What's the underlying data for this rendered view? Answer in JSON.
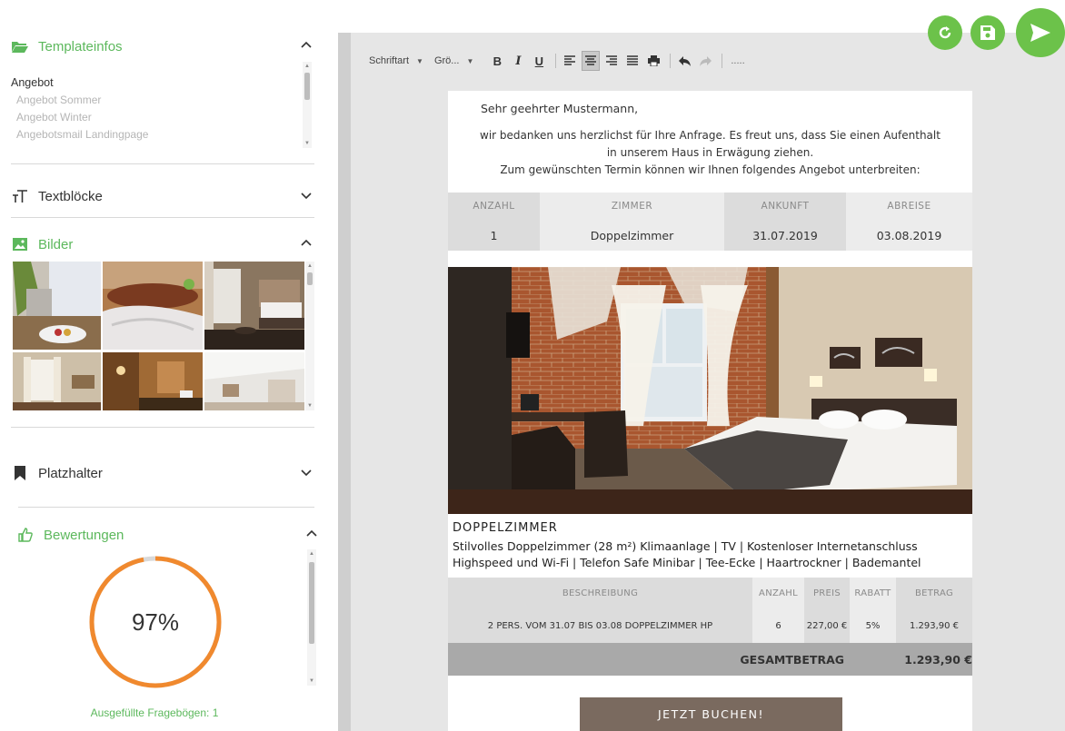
{
  "sidebar": {
    "templateinfos": {
      "title": "Templateinfos",
      "items": [
        {
          "label": "Angebot"
        },
        {
          "label": "Angebot Sommer"
        },
        {
          "label": "Angebot Winter"
        },
        {
          "label": "Angebotsmail Landingpage"
        }
      ]
    },
    "textbloecke": {
      "title": "Textblöcke"
    },
    "bilder": {
      "title": "Bilder"
    },
    "platzhalter": {
      "title": "Platzhalter"
    },
    "bewertungen": {
      "title": "Bewertungen",
      "percent_label": "97%",
      "percent_value": 97,
      "filled_label": "Ausgefüllte Fragebögen: 1"
    }
  },
  "toolbar": {
    "font_label": "Schriftart",
    "size_label": "Grö...",
    "more_label": "....."
  },
  "document": {
    "greeting": "Sehr geehrter Mustermann,",
    "intro_lines": [
      "wir bedanken uns herzlichst für Ihre Anfrage. Es freut uns, dass Sie einen Aufenthalt",
      "in unserem Haus in Erwägung ziehen.",
      "Zum gewünschten Termin können wir Ihnen folgendes Angebot unterbreiten:"
    ],
    "booking": {
      "headers": [
        "ANZAHL",
        "ZIMMER",
        "ANKUNFT",
        "ABREISE"
      ],
      "row": [
        "1",
        "Doppelzimmer",
        "31.07.2019",
        "03.08.2019"
      ]
    },
    "room_title": "DOPPELZIMMER",
    "room_desc": "Stilvolles Doppelzimmer (28 m²) Klimaanlage | TV | Kostenloser Internetanschluss Highspeed und Wi-Fi | Telefon Safe Minibar | Tee-Ecke | Haartrockner | Bademantel",
    "pricing": {
      "headers": [
        "BESCHREIBUNG",
        "ANZAHL",
        "PREIS",
        "RABATT",
        "BETRAG"
      ],
      "row": [
        "2 PERS. VOM 31.07 BIS 03.08 DOPPELZIMMER HP",
        "6",
        "227,00 €",
        "5%",
        "1.293,90 €"
      ],
      "total_label": "GESAMTBETRAG",
      "total_value": "1.293,90 €"
    },
    "book_button": "JETZT BUCHEN!"
  },
  "colors": {
    "accent_green": "#6cc24a",
    "text_green": "#5cb85c",
    "donut_orange": "#f0892e",
    "button_brown": "#7a6a5f"
  }
}
